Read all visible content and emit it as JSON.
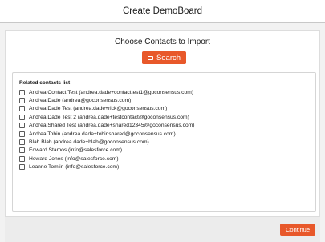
{
  "header": {
    "title": "Create DemoBoard"
  },
  "main": {
    "subtitle": "Choose Contacts to Import",
    "search_label": "Search"
  },
  "contacts": {
    "heading": "Related contacts list",
    "items": [
      {
        "label": "Andrea Contact Test (andrea.dade+contacttest1@goconsensus.com)",
        "checked": false
      },
      {
        "label": "Andrea Dade (andrea@goconsensus.com)",
        "checked": false
      },
      {
        "label": "Andrea Dade Test (andrea.dade+rick@goconsensus.com)",
        "checked": false
      },
      {
        "label": "Andrea Dade Test 2 (andrea.dade+testcontact@goconsensus.com)",
        "checked": false
      },
      {
        "label": "Andrea Shared Test (andrea.dade+shared12345@goconsensus.com)",
        "checked": false
      },
      {
        "label": "Andrea Tobin (andrea.dade+tobinshared@goconsensus.com)",
        "checked": false
      },
      {
        "label": "Blah Blah (andrea.dade+blah@goconsensus.com)",
        "checked": false
      },
      {
        "label": "Edward Stamos (info@salesforce.com)",
        "checked": false
      },
      {
        "label": "Howard Jones (info@salesforce.com)",
        "checked": false
      },
      {
        "label": "Leanne Tomlin (info@salesforce.com)",
        "checked": false
      }
    ]
  },
  "footer": {
    "continue_label": "Continue"
  },
  "colors": {
    "accent": "#e8582a"
  }
}
